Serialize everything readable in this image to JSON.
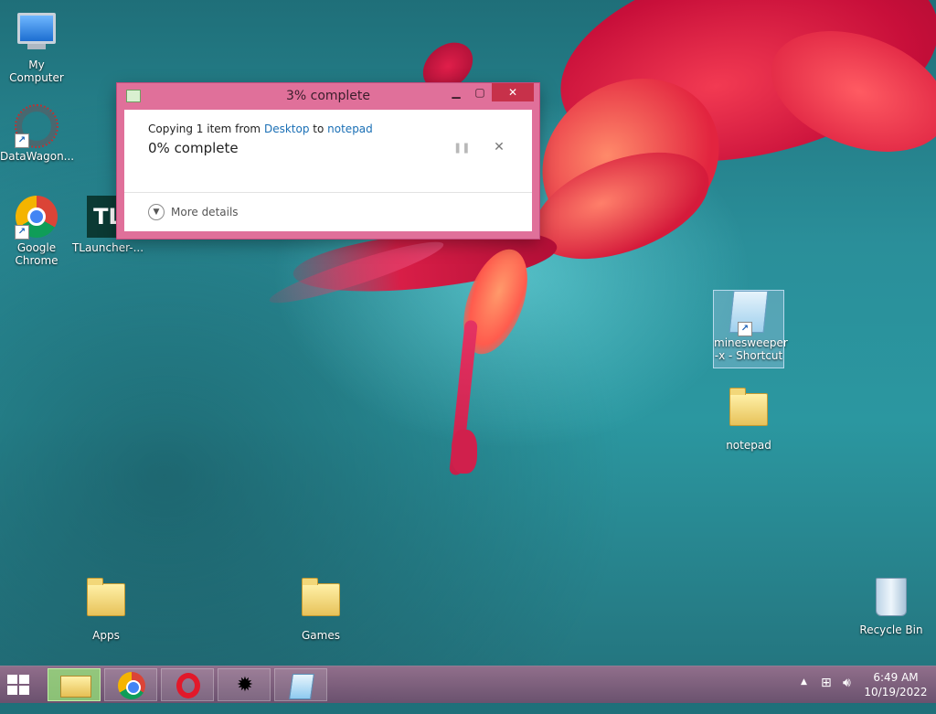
{
  "desktop": {
    "icons": [
      {
        "label": "My Computer"
      },
      {
        "label": "DataWagon..."
      },
      {
        "label": "Google Chrome"
      },
      {
        "label": "TLauncher-..."
      },
      {
        "label": "minesweeper -x - Shortcut"
      },
      {
        "label": "notepad"
      },
      {
        "label": "Apps"
      },
      {
        "label": "Games"
      },
      {
        "label": "Recycle Bin"
      }
    ],
    "tlauncher_glyph": "TL"
  },
  "dialog": {
    "title": "3% complete",
    "copying_prefix": "Copying 1 item from",
    "source": "Desktop",
    "to_word": "to",
    "destination": "notepad",
    "percent_text": "0% complete",
    "more_details": "More details",
    "progress_percent": 3,
    "icons": {
      "minimize": "minimize-icon",
      "maximize": "maximize-icon",
      "close": "close-icon",
      "pause": "pause-icon",
      "cancel": "cancel-icon",
      "expand": "chevron-down-icon"
    }
  },
  "taskbar": {
    "pinned": [
      "file-explorer-icon",
      "chrome-icon",
      "opera-icon",
      "minesweeper-icon",
      "notepad-icon"
    ],
    "clock": {
      "time": "6:49 AM",
      "date": "10/19/2022"
    }
  },
  "colors": {
    "dialog_frame": "#e0709a",
    "close_button": "#c7314a",
    "link": "#1a6fb5",
    "taskbar": "#8a6a8a"
  }
}
